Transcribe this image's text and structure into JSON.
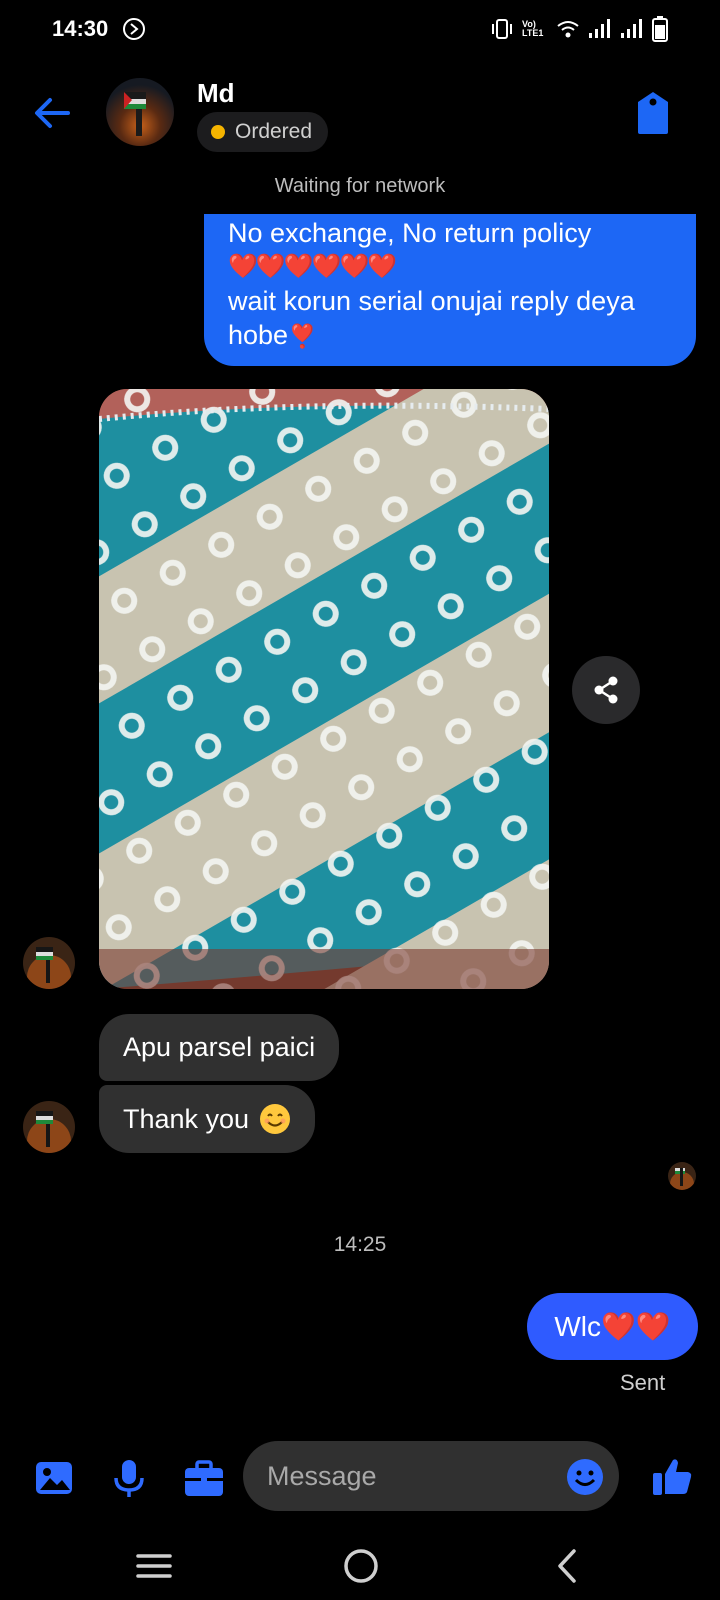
{
  "status_bar": {
    "time": "14:30",
    "network_label": "Vo) LTE1"
  },
  "header": {
    "contact_name": "Md",
    "status_label": "Ordered"
  },
  "network_note": "Waiting for network",
  "messages": {
    "outgoing_1": {
      "line1": "No exchange,  No return policy",
      "hearts": "❤️❤️❤️❤️❤️❤️",
      "line2": "wait korun serial onujai reply deya hobe",
      "heart_end": "❣️"
    },
    "incoming_1": "Apu parsel paici",
    "incoming_2": "Thank you",
    "timestamp": "14:25",
    "outgoing_2": "Wlc❤️❤️",
    "sent_status": "Sent"
  },
  "composer": {
    "placeholder": "Message"
  },
  "colors": {
    "background": "#000000",
    "accent": "#1d67f5",
    "outgoing_bubble": "#1d67f5",
    "incoming_bubble": "#303030",
    "status_dot": "#f5b400"
  },
  "icons": [
    "back-arrow-icon",
    "tag-icon",
    "share-icon",
    "image-icon",
    "microphone-icon",
    "briefcase-icon",
    "emoji-icon",
    "thumbs-up-icon",
    "menu-icon",
    "home-icon",
    "back-nav-icon"
  ]
}
